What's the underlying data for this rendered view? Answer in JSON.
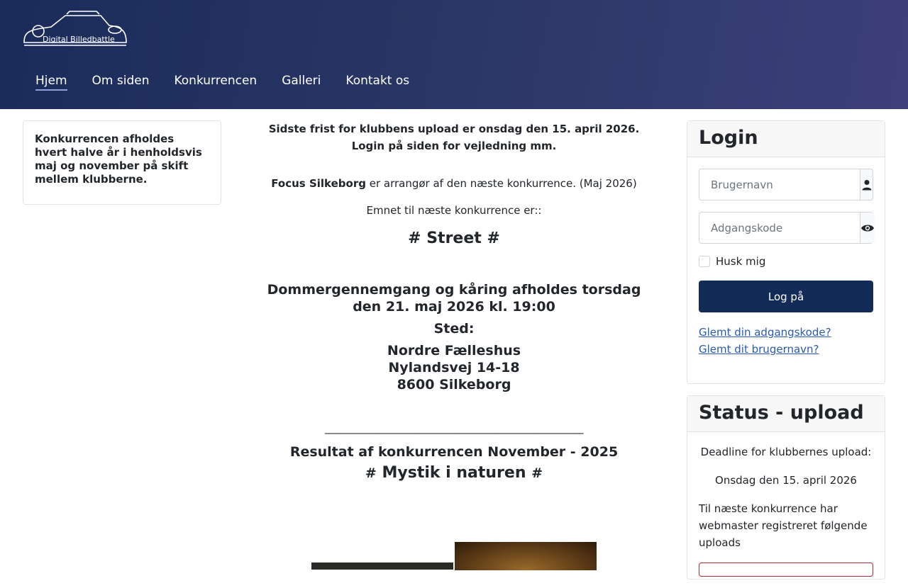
{
  "header": {
    "logo_text": "Digital Billedbattle",
    "nav": [
      {
        "label": "Hjem",
        "active": true
      },
      {
        "label": "Om siden",
        "active": false
      },
      {
        "label": "Konkurrencen",
        "active": false
      },
      {
        "label": "Galleri",
        "active": false
      },
      {
        "label": "Kontakt os",
        "active": false
      }
    ]
  },
  "left": {
    "text_line1": "Konkurrencen afholdes hvert halve år i henholdsvis",
    "text_line2": "maj og november på skift mellem klubberne."
  },
  "main": {
    "deadline_line1": "Sidste frist for klubbens upload er onsdag den 15. april 2026.",
    "deadline_line2": "Login på siden for vejledning mm.",
    "organizer_name": "Focus Silkeborg",
    "organizer_rest": " er arrangør af den næste konkurrence. (Maj 2026)",
    "topic_intro": "Emnet til næste konkurrence er::",
    "topic": "# Street #",
    "judging": "Dommergennemgang og kåring afholdes torsdag den 21. maj 2026 kl. 19:00",
    "sted_label": "Sted:",
    "address_line1": "Nordre Fælleshus",
    "address_line2": "Nylandsvej 14-18",
    "address_line3": "8600 Silkeborg",
    "rule": "____________________________________________________",
    "results_title": "Resultat af konkurrencen November - 2025",
    "prev_topic_hash1": "#",
    "prev_topic": " Mystik i naturen ",
    "prev_topic_hash2": "#"
  },
  "login": {
    "title": "Login",
    "username_placeholder": "Brugernavn",
    "password_placeholder": "Adgangskode",
    "remember_label": "Husk mig",
    "submit_label": "Log på",
    "forgot_password": "Glemt din adgangskode?",
    "forgot_username": "Glemt dit brugernavn?"
  },
  "status": {
    "title": "Status - upload",
    "deadline_label": "Deadline for klubbernes upload:",
    "deadline_date": "Onsdag den 15. april 2026",
    "info": "Til næste konkurrence har webmaster registreret følgende uploads"
  },
  "colors": {
    "header_start": "#1a2b5a",
    "header_end": "#3d3f7a",
    "button": "#132b57",
    "link": "#2a5ab0"
  },
  "icons": [
    "camera-logo",
    "user-icon",
    "eye-icon"
  ]
}
